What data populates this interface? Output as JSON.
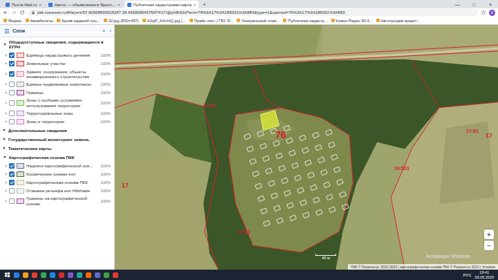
{
  "browser": {
    "tabs": [
      {
        "label": "Почта Mail.ru",
        "selected": false
      },
      {
        "label": "Авито — объявления в Яросл...",
        "selected": false
      },
      {
        "label": "Публичная кадастровая карта",
        "selected": true
      }
    ],
    "tab_close": "×",
    "new_tab": "+",
    "window_controls": [
      "—",
      "□",
      "×"
    ],
    "address": "pkk.rosreestr.ru/#/layers/57.60568830625187,39.43605864576974/17/@ph8r92d?text=76%3A17%3A185001%3A883&type=1&opened=76%3A17%3A185001%3A883",
    "profile": "V",
    "bookmarks": [
      "Яндекс",
      "Авиабилеты",
      "Архив заданий про...",
      "22.jpg (830×457)",
      "4JtqP_AAchIQ.jpg (...",
      "Прайс-лист | ГБУ Я...",
      "Генеральный план...",
      "Публичная кадастр...",
      "Новое Радио 90.4...",
      "Автопродаж кредит..."
    ]
  },
  "sidebar": {
    "title": "Слои",
    "close": "×",
    "collapse": "‹",
    "groups": [
      {
        "title": "Общедоступные сведения, содержащиеся в ЕГРН",
        "expanded": true,
        "layers": [
          {
            "label": "Единицы кадастрового деления",
            "checked": true,
            "opacity": "100%",
            "color": "#d9534f"
          },
          {
            "label": "Земельные участки",
            "checked": true,
            "opacity": "100%",
            "color": "#c9302c"
          },
          {
            "label": "Здания, сооружения, объекты незавершенного строительства",
            "checked": true,
            "opacity": "100%",
            "color": "#e87c8a"
          },
          {
            "label": "Единые недвижимые комплексы",
            "checked": false,
            "opacity": "100%",
            "color": "#9e9e9e"
          },
          {
            "label": "Границы",
            "checked": false,
            "opacity": "100%",
            "color": "#8e3b8e"
          },
          {
            "label": "Зоны с особыми условиями использования территории",
            "checked": false,
            "opacity": "100%",
            "color": "#6dbb3f"
          },
          {
            "label": "Территориальные зоны",
            "checked": false,
            "opacity": "100%",
            "color": "#b58bd1"
          },
          {
            "label": "Зоны и территории",
            "checked": false,
            "opacity": "100%",
            "color": "#d67bc1"
          }
        ]
      },
      {
        "title": "Дополнительные сведения",
        "expanded": false,
        "layers": []
      },
      {
        "title": "Государственный мониторинг земель",
        "expanded": false,
        "layers": []
      },
      {
        "title": "Тематические карты",
        "expanded": false,
        "layers": []
      },
      {
        "title": "Картографическая основа ПКК",
        "expanded": true,
        "layers": [
          {
            "label": "Надписи картографической осн...",
            "checked": true,
            "opacity": "100%",
            "color": "#5b6f8c"
          },
          {
            "label": "Космические снимки esri",
            "checked": true,
            "opacity": "100%",
            "color": "#4a6b3a"
          },
          {
            "label": "Картографическая основа ПКК",
            "checked": true,
            "opacity": "100%",
            "color": "#c9b98a"
          },
          {
            "label": "Отмывка рельефа esri Hillshade",
            "checked": false,
            "opacity": "100%",
            "color": "#bdbdbd"
          },
          {
            "label": "Границы на картографической основе",
            "checked": false,
            "opacity": "100%",
            "color": "#9c4f9c"
          }
        ]
      }
    ]
  },
  "map": {
    "labels": [
      "76",
      "17",
      "17",
      "17:61",
      "17:61",
      "16:501",
      "17:61"
    ],
    "zoom": [
      "+",
      "−"
    ],
    "scale": "40 м",
    "attribution": "ПКК © Росреестр, 2010-2020 | картографическая основа ПКК © Росреестр 2010 | Условия",
    "watermark": "Активация Windows"
  },
  "taskbar": {
    "lang": "РУС",
    "time": "19:41",
    "date": "03.05.2020"
  }
}
